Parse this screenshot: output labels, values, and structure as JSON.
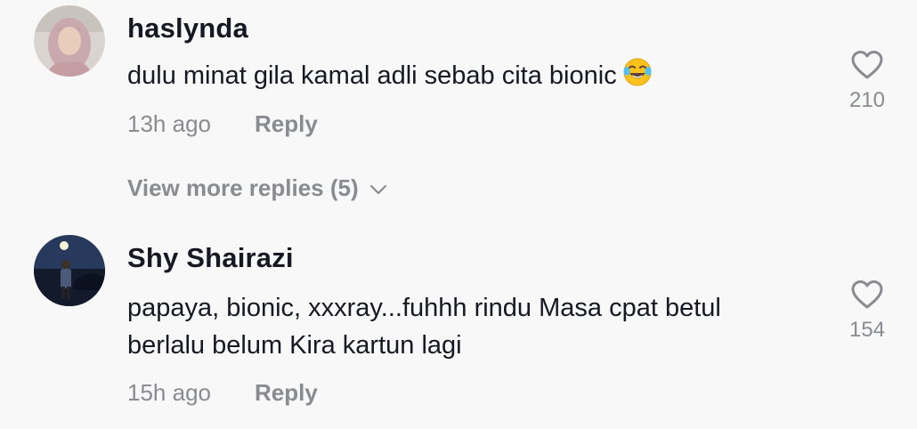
{
  "comments": [
    {
      "username": "haslynda",
      "text": "dulu minat gila kamal adli sebab cita bionic",
      "emoji": "face-with-tears-of-joy",
      "time": "13h ago",
      "reply_label": "Reply",
      "likes": "210",
      "icons": {
        "like": "heart-outline-icon"
      }
    },
    {
      "username": "Shy Shairazi",
      "text_lines": [
        "papaya, bionic, xxxray...fuhhh rindu Masa cpat betul",
        "berlalu belum Kira kartun lagi"
      ],
      "time": "15h ago",
      "reply_label": "Reply",
      "likes": "154",
      "icons": {
        "like": "heart-outline-icon"
      }
    }
  ],
  "more_replies": {
    "label": "View more replies (5)",
    "icon": "chevron-down-icon"
  },
  "colors": {
    "background": "#f8f8f8",
    "primary_text": "#161823",
    "secondary_text": "#8a8b91"
  }
}
